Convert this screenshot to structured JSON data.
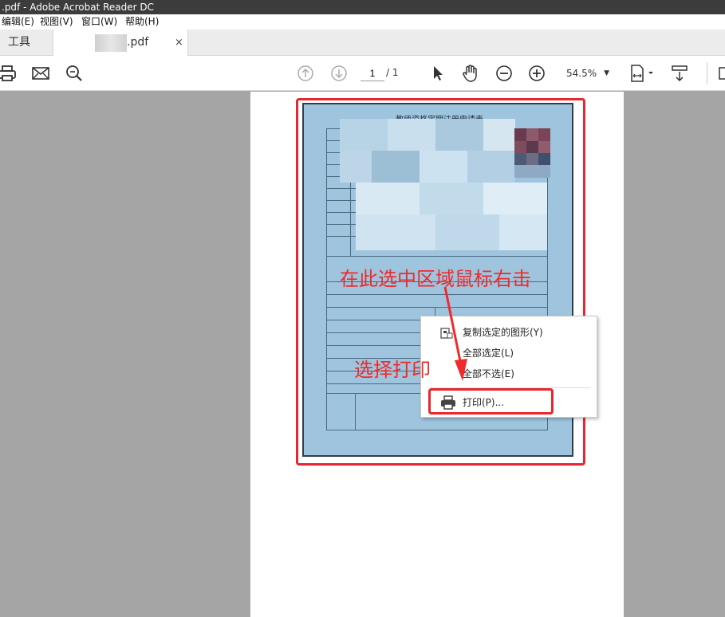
{
  "window": {
    "title": ".pdf - Adobe Acrobat Reader DC"
  },
  "menu": {
    "items": [
      "编辑(E)",
      "视图(V)",
      "窗口(W)",
      "帮助(H)"
    ]
  },
  "tabs": {
    "tools": "工具",
    "doc_name": ".pdf",
    "close": "×"
  },
  "toolbar": {
    "icons": [
      "printer-icon",
      "mail-icon",
      "search-icon",
      "page-up-icon",
      "page-down-icon",
      "select-cursor-icon",
      "hand-icon",
      "zoom-out-icon",
      "zoom-in-icon",
      "fit-page-icon",
      "scroll-icon"
    ],
    "page_current": "1",
    "page_total": "/ 1",
    "zoom": "54.5%"
  },
  "document": {
    "title": "教师资格定期注册申请表"
  },
  "context_menu": {
    "items": [
      {
        "label": "复制选定的图形(Y)",
        "icon": "copy-graphic-icon"
      },
      {
        "label": "全部选定(L)"
      },
      {
        "label": "全部不选(E)"
      },
      {
        "label": "打印(P)...",
        "icon": "printer-icon"
      }
    ]
  },
  "annotations": {
    "right_click": "在此选中区域鼠标右击",
    "choose_print": "选择打印",
    "color": "#f02a2a"
  }
}
